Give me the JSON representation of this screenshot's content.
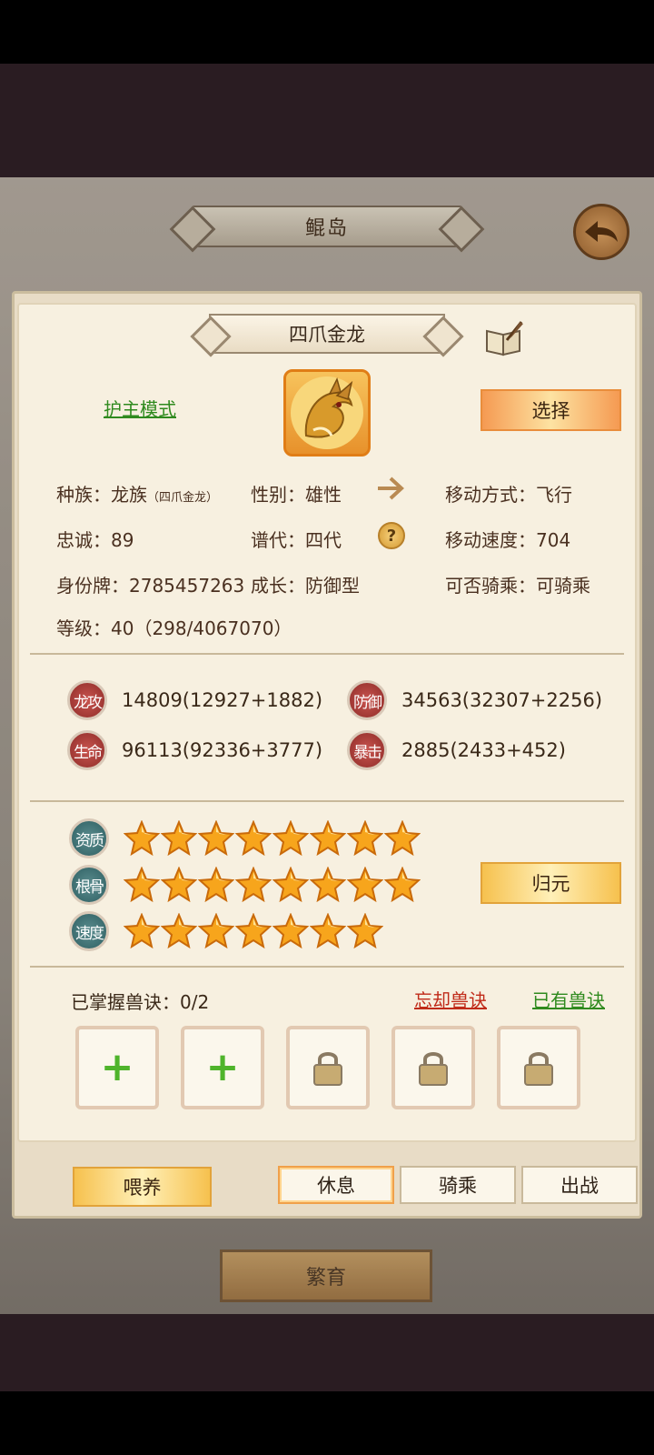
{
  "header": {
    "title": "鲲岛"
  },
  "pet": {
    "name": "四爪金龙",
    "mode_link": "护主模式",
    "select_button": "选择",
    "info": {
      "race_label": "种族：",
      "race_value": "龙族",
      "race_sub": "（四爪金龙）",
      "gender_label": "性别：",
      "gender_value": "雄性",
      "move_type_label": "移动方式：",
      "move_type_value": "飞行",
      "loyalty_label": "忠诚：",
      "loyalty_value": "89",
      "generation_label": "谱代：",
      "generation_value": "四代",
      "move_speed_label": "移动速度：",
      "move_speed_value": "704",
      "id_label": "身份牌：",
      "id_value": "2785457263",
      "growth_label": "成长：",
      "growth_value": "防御型",
      "rideable_label": "可否骑乘：",
      "rideable_value": "可骑乘",
      "level_label": "等级：",
      "level_value": "40（298/4067070）"
    },
    "stats": [
      {
        "badge": "龙攻",
        "value": "14809(12927+1882)"
      },
      {
        "badge": "防御",
        "value": "34563(32307+2256)"
      },
      {
        "badge": "生命",
        "value": "96113(92336+3777)"
      },
      {
        "badge": "暴击",
        "value": "2885(2433+452)"
      }
    ],
    "ratings": [
      {
        "badge": "资质",
        "stars": 8
      },
      {
        "badge": "根骨",
        "stars": 8
      },
      {
        "badge": "速度",
        "stars": 7
      }
    ],
    "reset_button": "归元",
    "skills": {
      "mastered_label": "已掌握兽诀：0/2",
      "forget_link": "忘却兽诀",
      "owned_link": "已有兽诀",
      "slots": [
        "add",
        "add",
        "locked",
        "locked",
        "locked"
      ]
    }
  },
  "actions": {
    "feed": "喂养",
    "rest": "休息",
    "ride": "骑乘",
    "battle": "出战"
  },
  "breed_button": "繁育",
  "colors": {
    "accent_orange": "#f59a52",
    "link_green": "#2f8a1e",
    "link_red": "#c02a18",
    "badge_red": "#8e2b28",
    "badge_teal": "#2e5f62"
  }
}
